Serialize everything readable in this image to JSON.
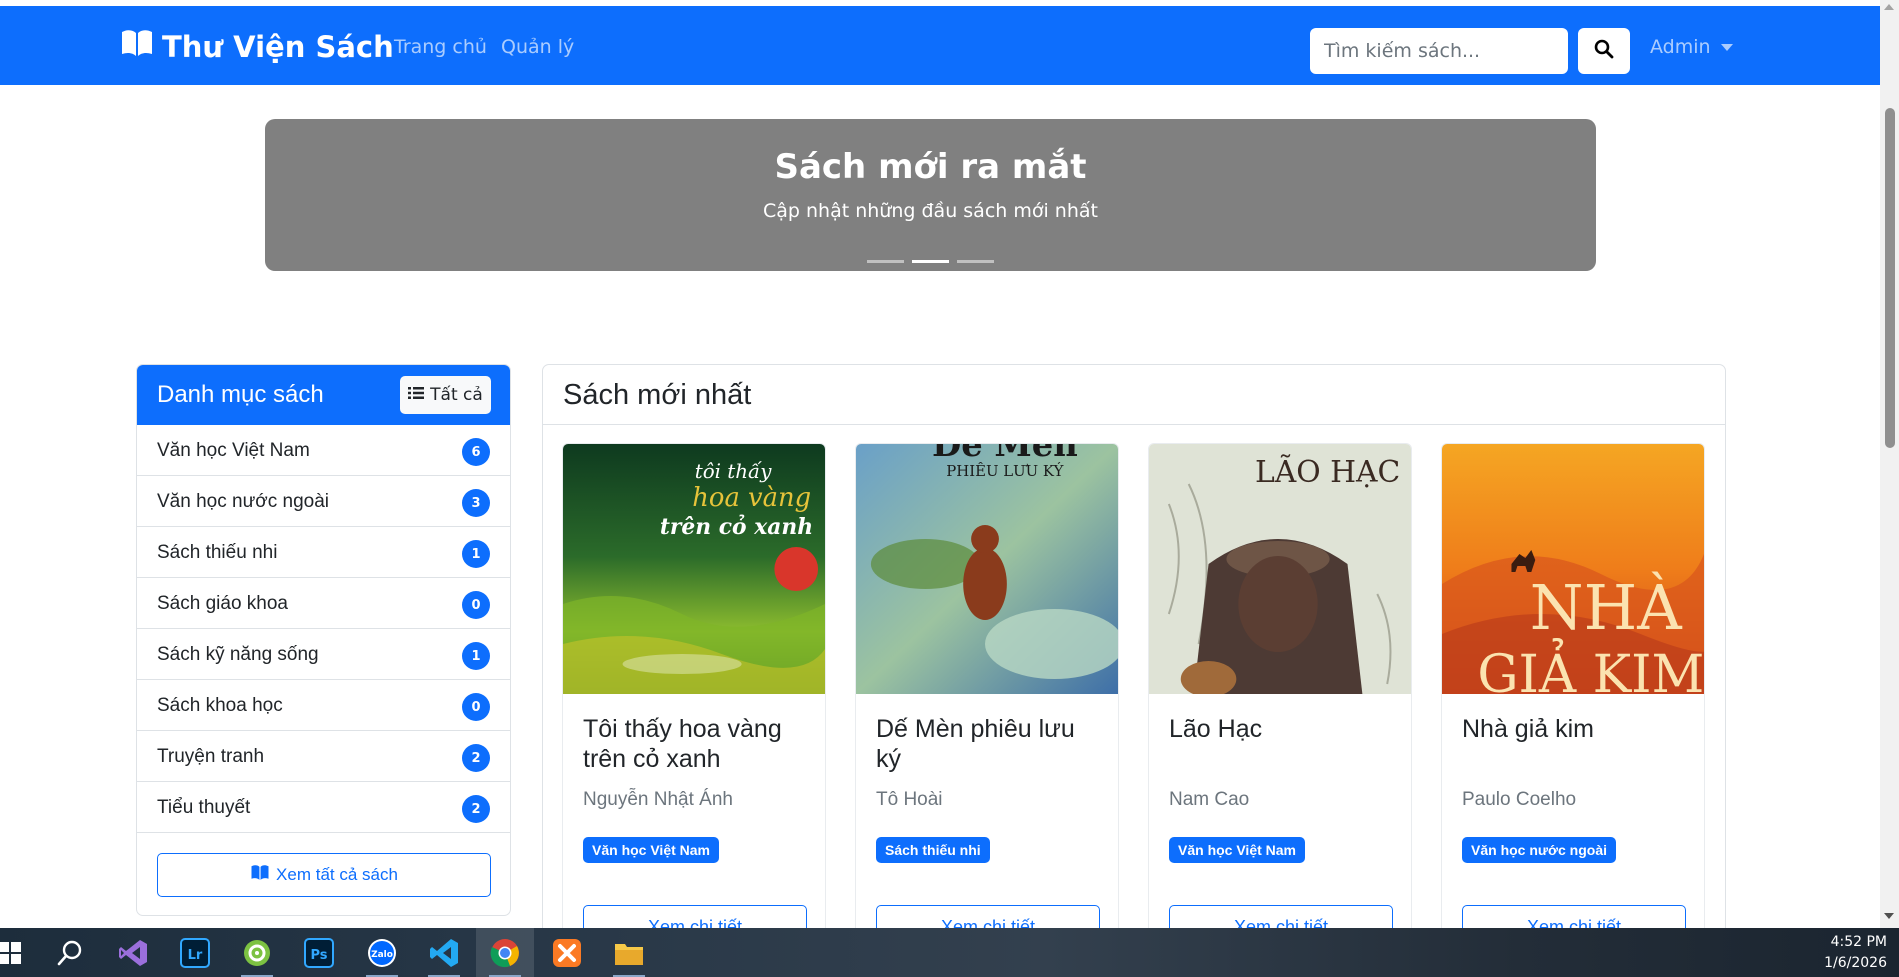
{
  "navbar": {
    "brand": "Thư Viện Sách",
    "links": [
      "Trang chủ",
      "Quản lý"
    ],
    "search_placeholder": "Tìm kiếm sách...",
    "user": "Admin",
    "color": "#0d6efd"
  },
  "carousel": {
    "title": "Sách mới ra mắt",
    "subtitle": "Cập nhật những đầu sách mới nhất",
    "slide_count": 3,
    "active_slide": 2
  },
  "categories": {
    "title": "Danh mục sách",
    "all_button": "Tất cả",
    "items": [
      {
        "name": "Văn học Việt Nam",
        "count": "6"
      },
      {
        "name": "Văn học nước ngoài",
        "count": "3"
      },
      {
        "name": "Sách thiếu nhi",
        "count": "1"
      },
      {
        "name": "Sách giáo khoa",
        "count": "0"
      },
      {
        "name": "Sách kỹ năng sống",
        "count": "1"
      },
      {
        "name": "Sách khoa học",
        "count": "0"
      },
      {
        "name": "Truyện tranh",
        "count": "2"
      },
      {
        "name": "Tiểu thuyết",
        "count": "2"
      }
    ],
    "view_all": "Xem tất cả sách"
  },
  "books": {
    "title": "Sách mới nhất",
    "items": [
      {
        "title": "Tôi thấy hoa vàng trên cỏ xanh",
        "author": "Nguyễn Nhật Ánh",
        "category": "Văn học Việt Nam",
        "button": "Xem chi tiết",
        "cover_text": [
          "tôi thấy",
          "hoa vàng",
          "trên cỏ xanh"
        ]
      },
      {
        "title": "Dế Mèn phiêu lưu ký",
        "author": "Tô Hoài",
        "category": "Sách thiếu nhi",
        "button": "Xem chi tiết",
        "cover_text": [
          "Dế Mèn",
          "PHIÊU LƯU KÝ"
        ]
      },
      {
        "title": "Lão Hạc",
        "author": "Nam Cao",
        "category": "Văn học Việt Nam",
        "button": "Xem chi tiết",
        "cover_text": [
          "LÃO HẠC"
        ]
      },
      {
        "title": "Nhà giả kim",
        "author": "Paulo Coelho",
        "category": "Văn học nước ngoài",
        "button": "Xem chi tiết",
        "cover_text": [
          "NHÀ",
          "GIẢ KIM"
        ]
      }
    ]
  },
  "taskbar": {
    "icons": [
      "windows-start-icon",
      "search-icon",
      "visual-studio-icon",
      "lightroom-icon",
      "greenshot-icon",
      "photoshop-icon",
      "zalo-icon",
      "vscode-icon",
      "chrome-icon",
      "xampp-icon",
      "file-explorer-icon"
    ],
    "zalo_label": "Zalo",
    "lr_label": "Lr",
    "ps_label": "Ps",
    "time": "4:52 PM",
    "date": "1/6/2026"
  }
}
